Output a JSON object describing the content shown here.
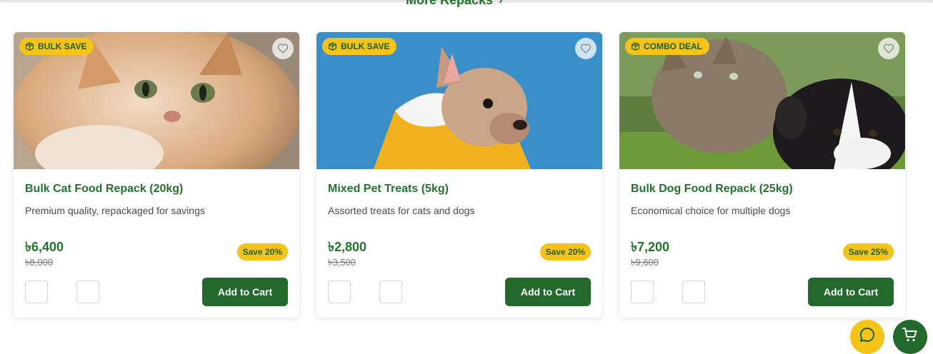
{
  "header": {
    "more_label": "More Repacks",
    "more_arrow": "›"
  },
  "products": [
    {
      "badge": "BULK SAVE",
      "title": "Bulk Cat Food Repack (20kg)",
      "description": "Premium quality, repackaged for savings",
      "price": "৳6,400",
      "old_price": "৳8,000",
      "discount": "Save 20%",
      "cta": "Add to Cart"
    },
    {
      "badge": "BULK SAVE",
      "title": "Mixed Pet Treats (5kg)",
      "description": "Assorted treats for cats and dogs",
      "price": "৳2,800",
      "old_price": "৳3,500",
      "discount": "Save 20%",
      "cta": "Add to Cart"
    },
    {
      "badge": "COMBO DEAL",
      "title": "Bulk Dog Food Repack (25kg)",
      "description": "Economical choice for multiple dogs",
      "price": "৳7,200",
      "old_price": "৳9,600",
      "discount": "Save 25%",
      "cta": "Add to Cart"
    }
  ],
  "icons": {
    "badge": "package-icon",
    "favorite": "heart-icon",
    "chat": "chat-bubble-icon",
    "cart": "shopping-cart-icon"
  },
  "colors": {
    "brand_green": "#23692b",
    "accent_yellow": "#f6c319"
  }
}
